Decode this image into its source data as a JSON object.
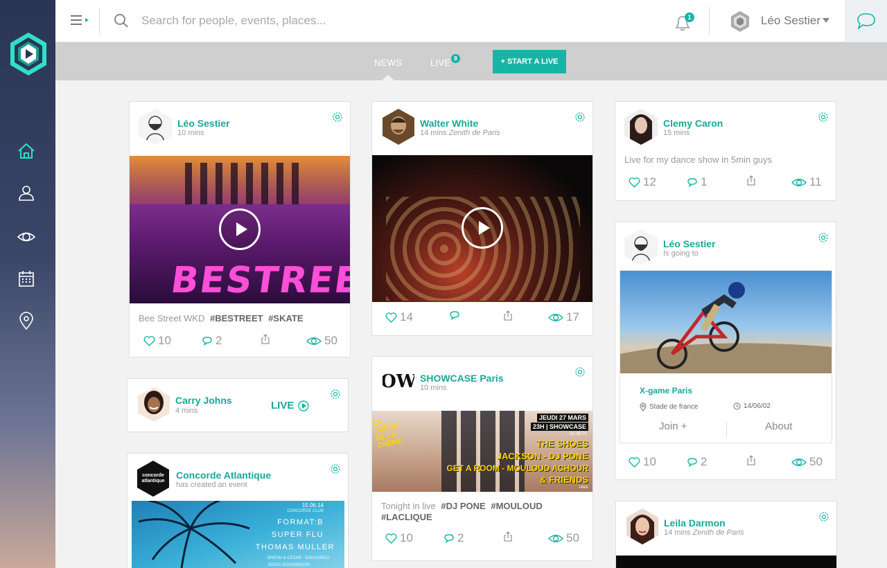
{
  "search": {
    "placeholder": "Search for people, events, places..."
  },
  "notifications": {
    "count": "1"
  },
  "user": {
    "name": "Léo Sestier"
  },
  "tabs": {
    "news": "NEWS",
    "live": "LIVE",
    "live_count": "8",
    "start_live": "+ START A LIVE"
  },
  "colors": {
    "accent": "#17b5a6",
    "sidebar_top": "#2a3554",
    "subnav": "#cfcfcf"
  },
  "sidebar": {
    "items": [
      "home-icon",
      "profile-icon",
      "eye-icon",
      "calendar-icon",
      "location-pin-icon"
    ]
  },
  "posts": {
    "p1": {
      "author": "Léo Sestier",
      "time": "10 mins",
      "caption": "Bee Street WKD",
      "tags": [
        "#BESTREET",
        "#SKATE"
      ],
      "likes": "10",
      "comments": "2",
      "views": "50",
      "image_text": "BESTREE"
    },
    "p2": {
      "author": "Walter White",
      "time": "14 mins",
      "place": "Zenith de Paris",
      "likes": "14",
      "views": "17"
    },
    "p3": {
      "author": "Clemy Caron",
      "time": "15 mins",
      "caption": "Live for my dance show in 5min guys",
      "likes": "12",
      "comments": "1",
      "views": "11"
    },
    "p4": {
      "author": "Carry Johns",
      "time": "4 mins",
      "live": "LIVE"
    },
    "p5": {
      "author": "SHOWCASE Paris",
      "time": "10 mins",
      "avatar_text": "OW",
      "caption": "Tonight in live",
      "tags": [
        "#DJ PONE",
        "#MOULOUD",
        "#LACLIQUE"
      ],
      "likes": "10",
      "comments": "2",
      "views": "50",
      "poster": {
        "title": "LA CRÈME DE LA CRÈME",
        "date": "JEUDI 27 MARS",
        "sub": "23H | SHOWCASE",
        "dj": "DJ SETS",
        "l1": "THE SHOES",
        "l2": "JACKSON - DJ PONE",
        "l3": "GET A ROOM - MOULOUD ACHOUR",
        "l4": "& FRIENDS",
        "free": "FREE"
      }
    },
    "p6": {
      "author": "Léo Sestier",
      "time": "Is going to",
      "event": "X-game Paris",
      "venue": "Stade de france",
      "date": "14/06/02",
      "join": "Join +",
      "about": "About",
      "likes": "10",
      "comments": "2",
      "views": "50"
    },
    "p7": {
      "author": "Concorde Atlantique",
      "time": "has created an event",
      "avatar_text": "concorde atlantique",
      "poster": {
        "date": "15.06.14",
        "club": "CONCORDE CLUB",
        "l1": "FORMAT:B",
        "l2": "SUPER FLU",
        "l3": "THOMAS MULLER",
        "l4": "BREHN & CESAR · EDOUARDO",
        "l5": "JEDSA SOUNDBOOM"
      }
    },
    "p8": {
      "author": "Leila Darmon",
      "time": "14 mins",
      "place": "Zenith de Paris"
    }
  }
}
